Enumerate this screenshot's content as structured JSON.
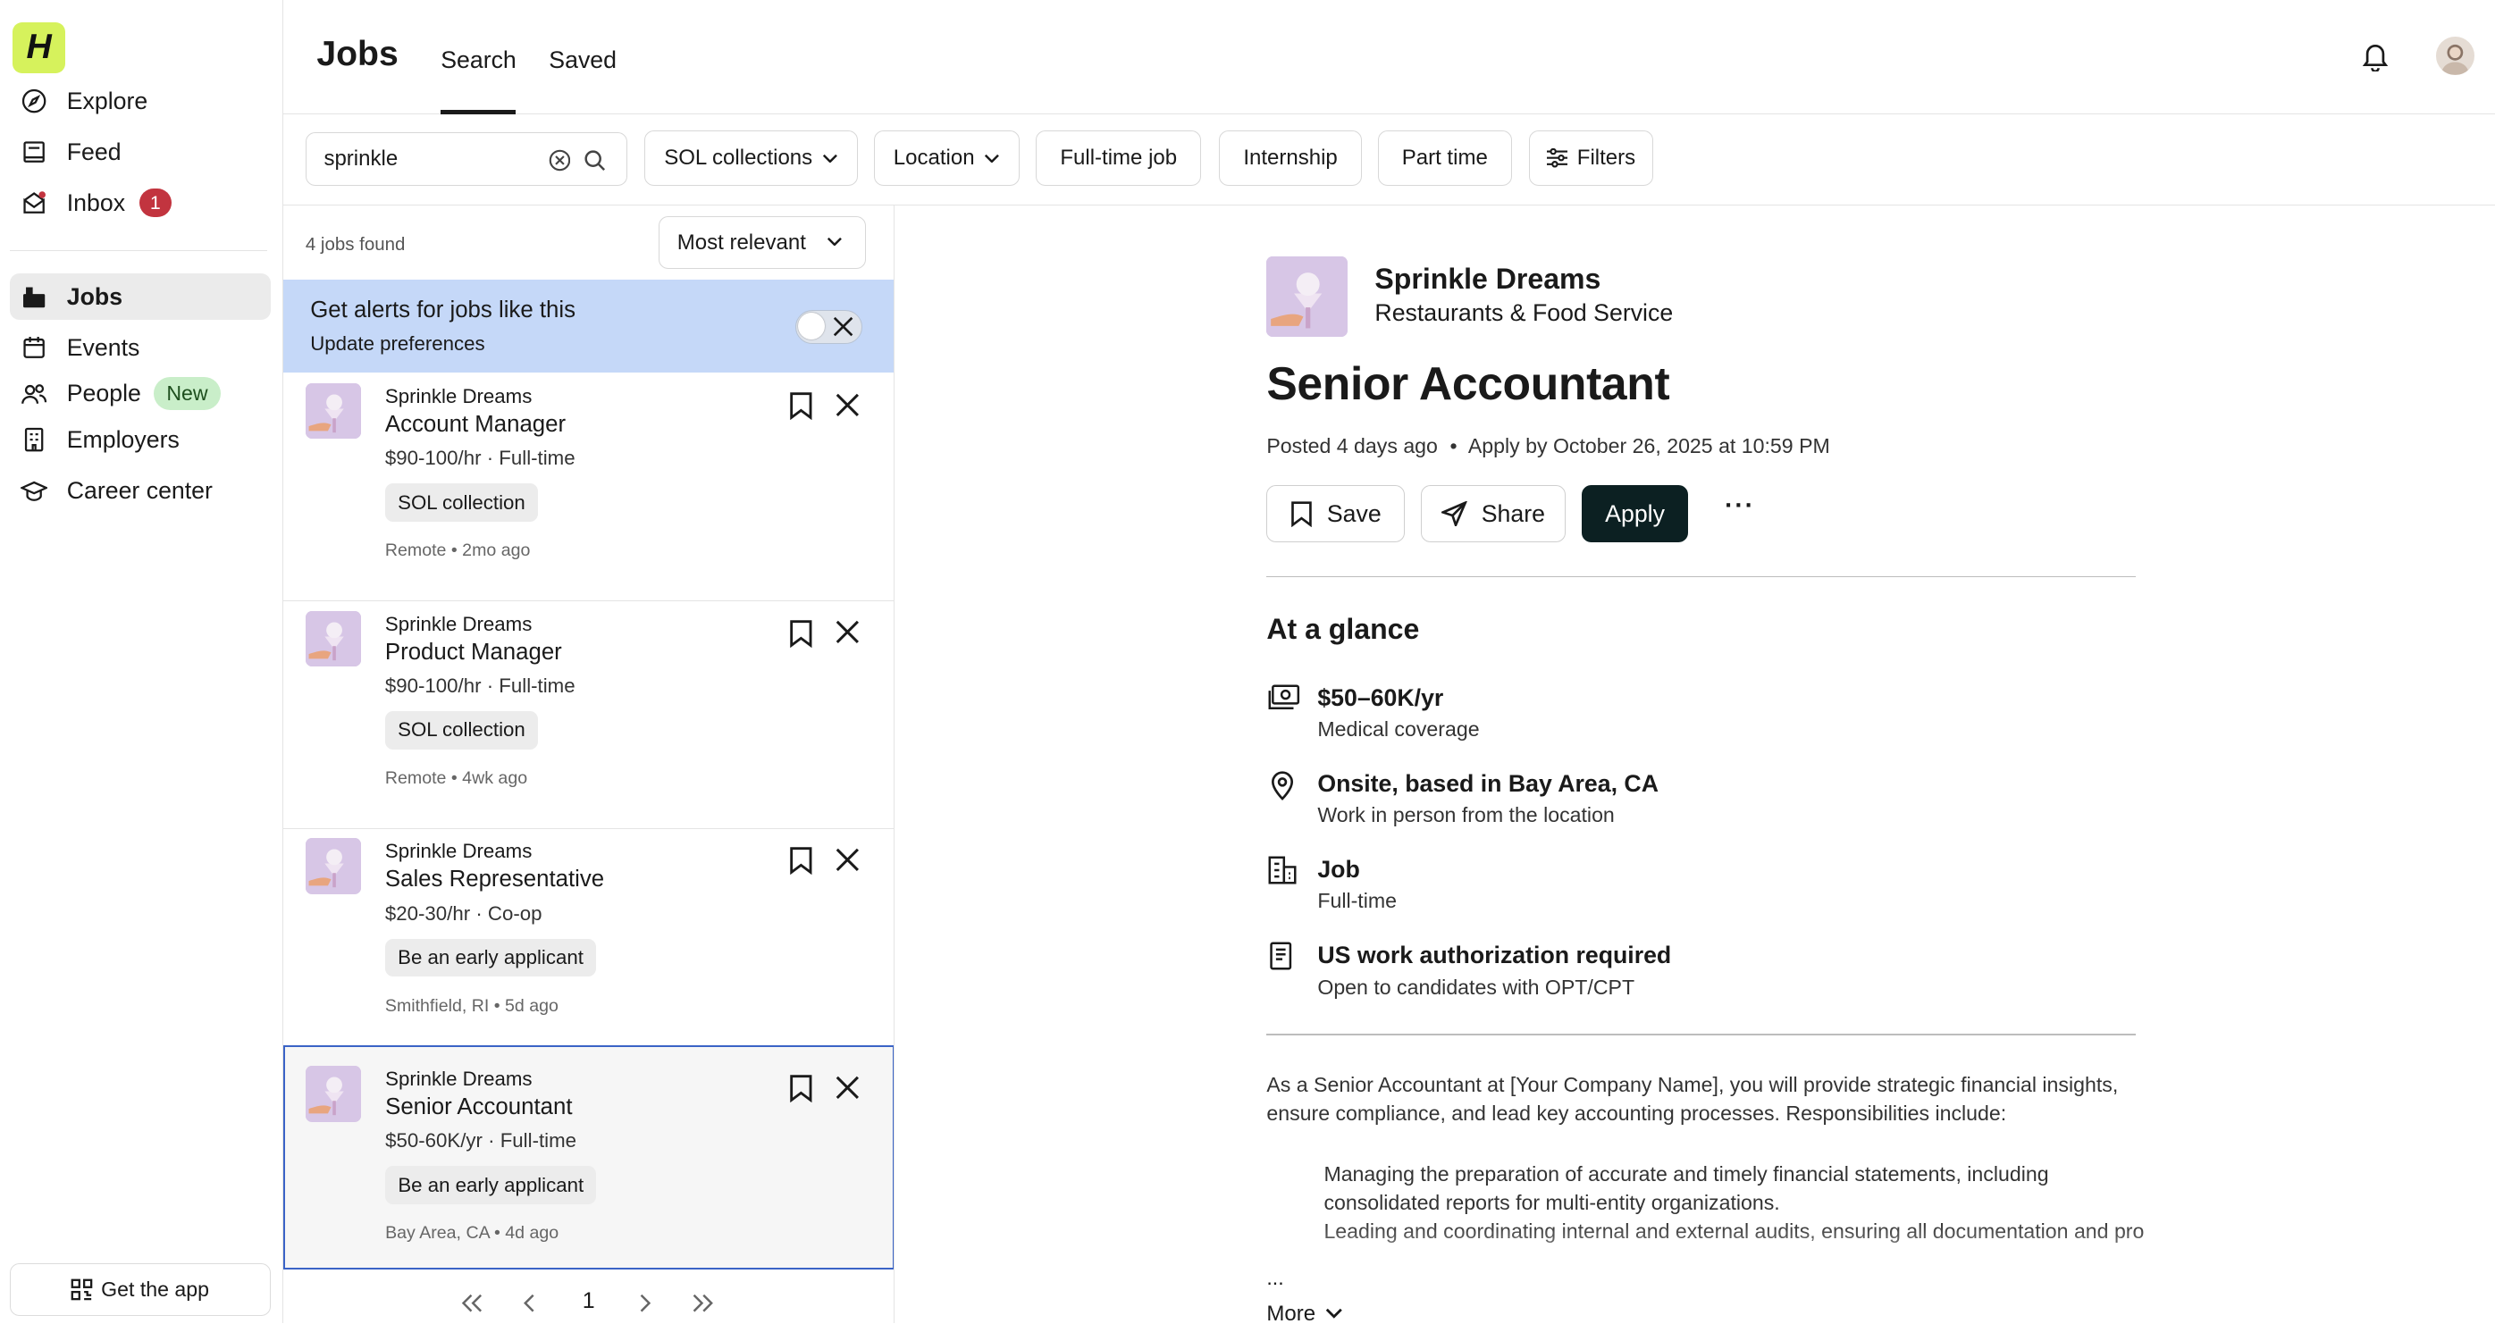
{
  "app": {
    "logo": "H"
  },
  "sidebar": {
    "items": [
      {
        "label": "Explore",
        "icon": "compass-icon"
      },
      {
        "label": "Feed",
        "icon": "feed-icon"
      },
      {
        "label": "Inbox",
        "icon": "inbox-icon",
        "badge": "1"
      },
      {
        "label": "Jobs",
        "icon": "briefcase-icon",
        "active": true
      },
      {
        "label": "Events",
        "icon": "calendar-icon"
      },
      {
        "label": "People",
        "icon": "people-icon",
        "badge": "New"
      },
      {
        "label": "Employers",
        "icon": "building-icon"
      },
      {
        "label": "Career center",
        "icon": "graduation-cap-icon"
      }
    ],
    "get_app": "Get the app"
  },
  "header": {
    "title": "Jobs",
    "tabs": [
      {
        "label": "Search",
        "active": true
      },
      {
        "label": "Saved"
      }
    ]
  },
  "filters": {
    "search_value": "sprinkle",
    "chips": [
      {
        "label": "SOL collections",
        "dropdown": true
      },
      {
        "label": "Location",
        "dropdown": true
      },
      {
        "label": "Full-time job"
      },
      {
        "label": "Internship"
      },
      {
        "label": "Part time"
      },
      {
        "label": "Filters",
        "icon": "sliders-icon"
      }
    ]
  },
  "list": {
    "count_text": "4 jobs found",
    "sort": "Most relevant",
    "alert": {
      "title": "Get alerts for jobs like this",
      "link": "Update preferences",
      "enabled": false
    },
    "jobs": [
      {
        "company": "Sprinkle Dreams",
        "title": "Account Manager",
        "pay": "$90-100/hr · Full-time",
        "tag": "SOL collection",
        "meta": "Remote • 2mo ago"
      },
      {
        "company": "Sprinkle Dreams",
        "title": "Product Manager",
        "pay": "$90-100/hr · Full-time",
        "tag": "SOL collection",
        "meta": "Remote • 4wk ago"
      },
      {
        "company": "Sprinkle Dreams",
        "title": "Sales Representative",
        "pay": "$20-30/hr · Co-op",
        "tag": "Be an early applicant",
        "meta": "Smithfield, RI • 5d ago"
      },
      {
        "company": "Sprinkle Dreams",
        "title": "Senior Accountant",
        "pay": "$50-60K/yr · Full-time",
        "tag": "Be an early applicant",
        "meta": "Bay Area, CA • 4d ago",
        "selected": true
      }
    ],
    "pager": {
      "page": "1"
    }
  },
  "detail": {
    "company": "Sprinkle Dreams",
    "industry": "Restaurants & Food Service",
    "title": "Senior Accountant",
    "posted": "Posted 4 days ago",
    "apply_by": "Apply by October 26, 2025 at 10:59 PM",
    "buttons": {
      "save": "Save",
      "share": "Share",
      "apply": "Apply",
      "more": "···"
    },
    "glance_title": "At a glance",
    "glance": [
      {
        "icon": "money-icon",
        "title": "$50–60K/yr",
        "sub": "Medical coverage"
      },
      {
        "icon": "location-pin-icon",
        "title": "Onsite, based in Bay Area, CA",
        "sub": "Work in person from the location"
      },
      {
        "icon": "building-icon",
        "title": "Job",
        "sub": "Full-time"
      },
      {
        "icon": "document-icon",
        "title": "US work authorization required",
        "sub": "Open to candidates with OPT/CPT"
      }
    ],
    "description": "As a Senior Accountant at [Your Company Name], you will provide strategic financial insights, ensure compliance, and lead key accounting processes. Responsibilities include:",
    "bullets": [
      "Managing the preparation of accurate and timely financial statements, including",
      "consolidated reports for multi-entity organizations.",
      "Leading and coordinating internal and external audits, ensuring all documentation and pro"
    ],
    "ellipsis": "...",
    "more_label": "More"
  },
  "colors": {
    "brand": "#d6f25c",
    "apply_bg": "#0c2022",
    "alert_bg": "#c5d8f8",
    "badge_red": "#c2343f",
    "badge_new": "#c9eec9",
    "selected_border": "#3a63c6"
  }
}
